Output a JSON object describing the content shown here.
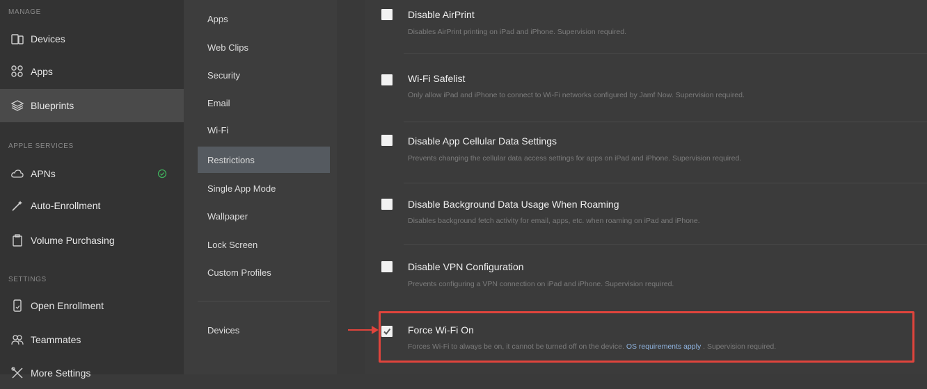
{
  "sidebar": {
    "sections": [
      {
        "label": "MANAGE"
      },
      {
        "label": "APPLE SERVICES"
      },
      {
        "label": "SETTINGS"
      }
    ],
    "items": [
      {
        "label": "Devices",
        "icon": "devices-icon"
      },
      {
        "label": "Apps",
        "icon": "apps-grid-icon"
      },
      {
        "label": "Blueprints",
        "icon": "layers-icon"
      },
      {
        "label": "APNs",
        "icon": "cloud-icon"
      },
      {
        "label": "Auto-Enrollment",
        "icon": "magic-wand-icon"
      },
      {
        "label": "Volume Purchasing",
        "icon": "clipboard-icon"
      },
      {
        "label": "Open Enrollment",
        "icon": "phone-enroll-icon"
      },
      {
        "label": "Teammates",
        "icon": "people-icon"
      },
      {
        "label": "More Settings",
        "icon": "tools-icon"
      }
    ],
    "apns_status_color": "#3fae5b"
  },
  "subnav": {
    "items": [
      {
        "label": "Apps"
      },
      {
        "label": "Web Clips"
      },
      {
        "label": "Security"
      },
      {
        "label": "Email"
      },
      {
        "label": "Wi-Fi"
      },
      {
        "label": "Restrictions"
      },
      {
        "label": "Single App Mode"
      },
      {
        "label": "Wallpaper"
      },
      {
        "label": "Lock Screen"
      },
      {
        "label": "Custom Profiles"
      },
      {
        "label": "Devices"
      }
    ],
    "active": "Restrictions"
  },
  "settings": [
    {
      "title": "Disable AirPrint",
      "desc": "Disables AirPrint printing on iPad and iPhone. Supervision required.",
      "checked": false
    },
    {
      "title": "Wi-Fi Safelist",
      "desc": "Only allow iPad and iPhone to connect to Wi-Fi networks configured by Jamf Now. Supervision required.",
      "checked": false
    },
    {
      "title": "Disable App Cellular Data Settings",
      "desc": "Prevents changing the cellular data access settings for apps on iPad and iPhone. Supervision required.",
      "checked": false
    },
    {
      "title": "Disable Background Data Usage When Roaming",
      "desc": "Disables background fetch activity for email, apps, etc. when roaming on iPad and iPhone.",
      "checked": false
    },
    {
      "title": "Disable VPN Configuration",
      "desc": "Prevents configuring a VPN connection on iPad and iPhone. Supervision required.",
      "checked": false
    },
    {
      "title": "Force Wi-Fi On",
      "desc_pre": "Forces Wi-Fi to always be on, it cannot be turned off on the device. ",
      "desc_link": "OS requirements apply",
      "desc_post": " . Supervision required.",
      "checked": true
    }
  ],
  "colors": {
    "highlight": "#e0443c",
    "link": "#8fb4e0"
  }
}
